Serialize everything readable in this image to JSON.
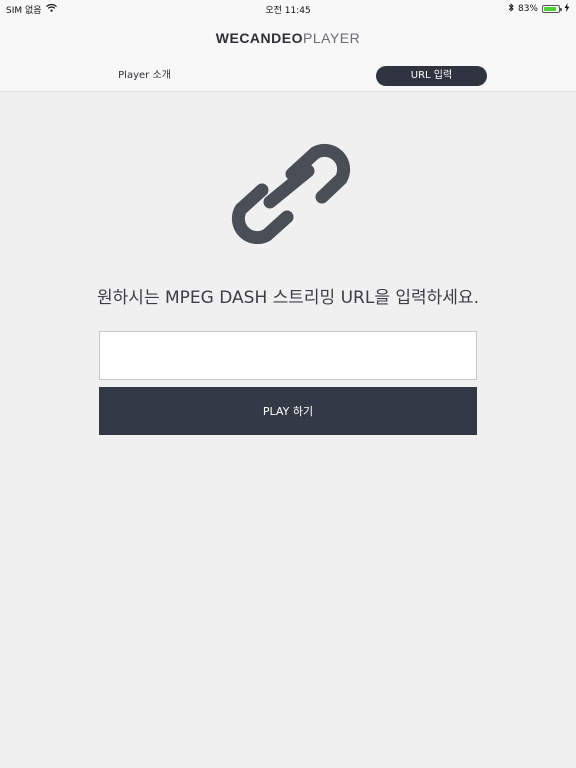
{
  "status_bar": {
    "carrier": "SIM 없음",
    "time": "오전 11:45",
    "battery_percent": "83%",
    "battery_level": 0.83,
    "icons": [
      "wifi-icon",
      "bluetooth-icon",
      "battery-icon",
      "charging-icon"
    ]
  },
  "header": {
    "logo_main": "WECANDEO",
    "logo_sub": "PLAYER"
  },
  "tabs": [
    {
      "label": "Player 소개",
      "active": false
    },
    {
      "label": "URL 입력",
      "active": true
    }
  ],
  "main": {
    "icon": "link-icon",
    "headline": "원하시는 MPEG DASH 스트리밍 URL을 입력하세요.",
    "url_input": {
      "value": "",
      "placeholder": ""
    },
    "play_button_label": "PLAY 하기"
  },
  "colors": {
    "background": "#f0f0f0",
    "dark_accent": "#343a45",
    "icon_gray": "#4a4e56",
    "battery_green": "#4cd137"
  }
}
